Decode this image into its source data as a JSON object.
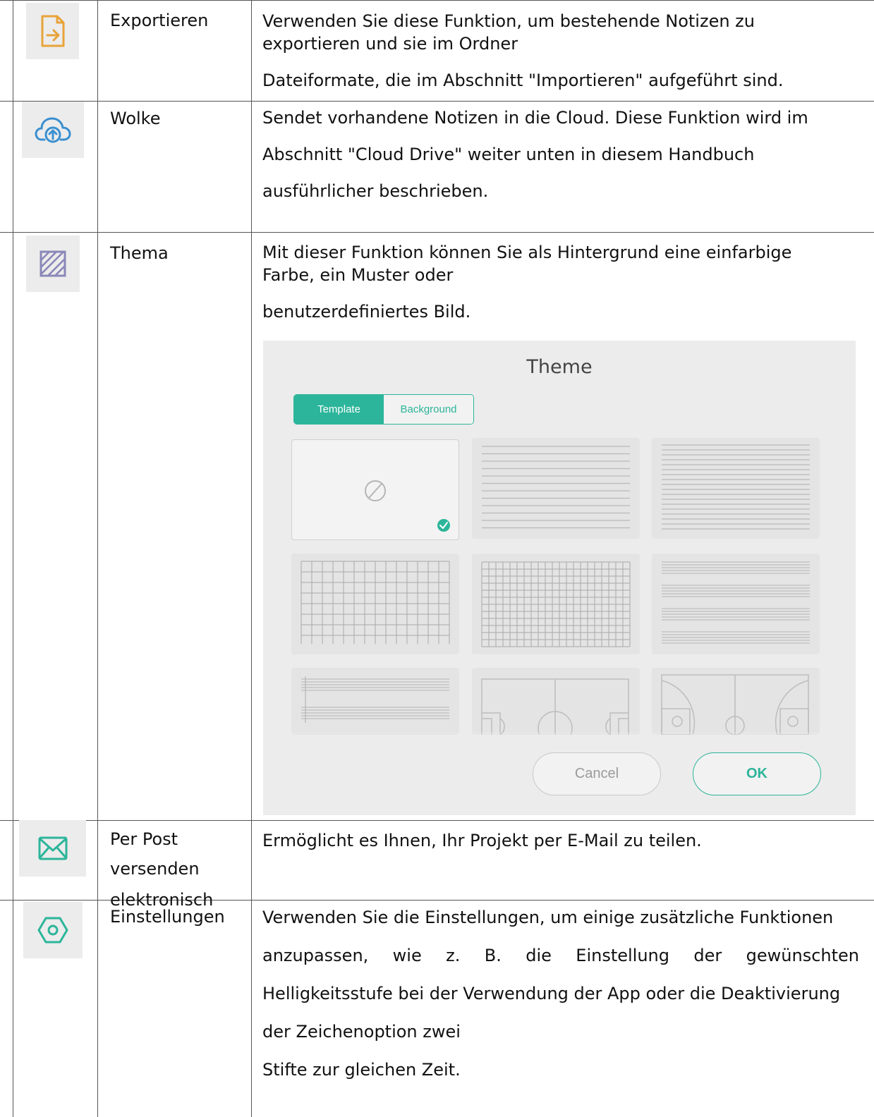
{
  "rows": [
    {
      "icon": "export-icon",
      "name_lines": [
        "Exportieren"
      ],
      "description": [
        "Verwenden Sie diese Funktion, um bestehende Notizen zu",
        "exportieren und sie im Ordner",
        "Dateiformate, die im Abschnitt \"Importieren\" aufgeführt sind."
      ]
    },
    {
      "icon": "cloud-upload-icon",
      "name_lines": [
        "Wolke"
      ],
      "description": [
        "Sendet vorhandene Notizen in die Cloud. Diese Funktion wird im",
        "Abschnitt \"Cloud Drive\" weiter unten in diesem Handbuch",
        "ausführlicher beschrieben."
      ]
    },
    {
      "icon": "theme-pattern-icon",
      "name_lines": [
        "Thema"
      ],
      "description": [
        "Mit dieser Funktion können Sie als Hintergrund eine einfarbige",
        "Farbe, ein Muster oder",
        "benutzerdefiniertes Bild."
      ]
    },
    {
      "icon": "mail-icon",
      "name_lines": [
        "Per Post",
        "versenden",
        "elektronisch"
      ],
      "description": [
        "Ermöglicht es Ihnen, Ihr Projekt per E-Mail zu teilen."
      ]
    },
    {
      "icon": "settings-hexagon-icon",
      "name_lines": [
        "Einstellungen"
      ],
      "description": [
        "Verwenden Sie die Einstellungen, um einige zusätzliche Funktionen",
        "anzupassen, wie z. B. die Einstellung der gewünschten",
        "Helligkeitsstufe bei der Verwendung der App oder die Deaktivierung",
        "der Zeichenoption zwei",
        "Stifte zur gleichen Zeit."
      ]
    }
  ],
  "theme_dialog": {
    "title": "Theme",
    "tabs": [
      {
        "label": "Template",
        "active": true
      },
      {
        "label": "Background",
        "active": false
      }
    ],
    "templates": [
      "none",
      "wide-ruled-lines",
      "narrow-ruled-lines",
      "large-grid",
      "small-grid",
      "staff-lines",
      "music-staff",
      "football-field",
      "basketball-court"
    ],
    "cancel_label": "Cancel",
    "ok_label": "OK"
  },
  "colors": {
    "accent": "#2cb59a",
    "export_icon": "#e8a33a",
    "cloud_icon": "#3a8fd0",
    "theme_icon": "#8a87b8",
    "mail_icon": "#2cb59a",
    "settings_icon": "#2cb59a"
  }
}
